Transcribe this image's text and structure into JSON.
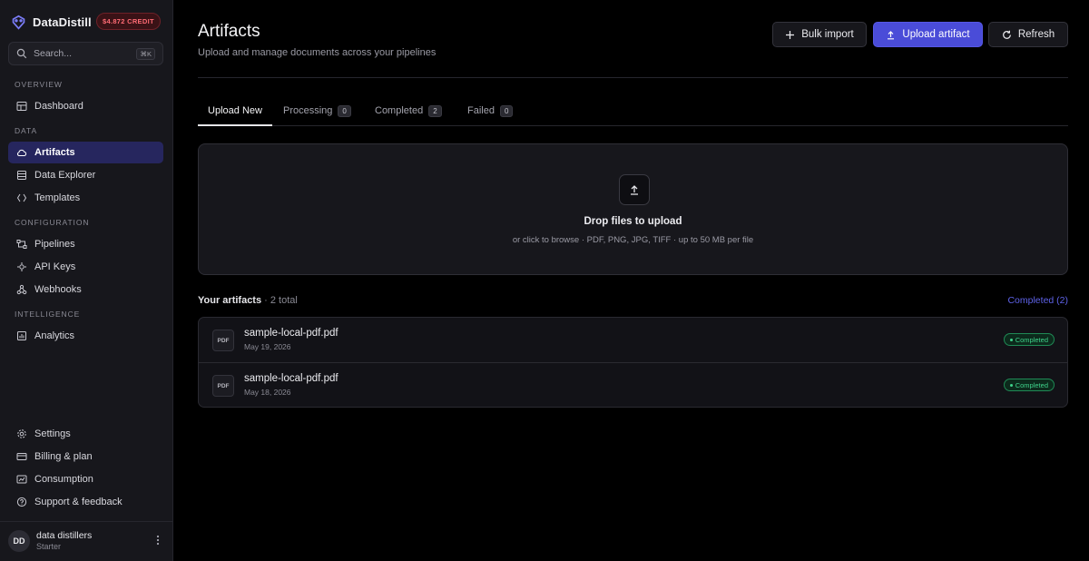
{
  "app": {
    "name": "DataDistill",
    "credit_badge": "$4.872 CREDIT",
    "brand_color": "#6e6ff0"
  },
  "search": {
    "placeholder": "Search...",
    "shortcut": "⌘K"
  },
  "sidebar": {
    "sections": [
      {
        "label": "OVERVIEW"
      },
      {
        "label": "DATA"
      },
      {
        "label": "CONFIGURATION"
      },
      {
        "label": "INTELLIGENCE"
      }
    ],
    "items": [
      {
        "label": "Dashboard",
        "icon": "dashboard-icon",
        "active": false
      },
      {
        "label": "Artifacts",
        "icon": "cloud-icon",
        "active": true
      },
      {
        "label": "Data Explorer",
        "icon": "table-icon",
        "active": false
      },
      {
        "label": "Templates",
        "icon": "code-braces-icon",
        "active": false
      },
      {
        "label": "Pipelines",
        "icon": "pipeline-icon",
        "active": false
      },
      {
        "label": "API Keys",
        "icon": "key-icon",
        "active": false
      },
      {
        "label": "Webhooks",
        "icon": "webhook-icon",
        "active": false
      },
      {
        "label": "Analytics",
        "icon": "chart-icon",
        "active": false
      }
    ],
    "bottom_items": [
      {
        "label": "Settings",
        "icon": "gear-icon"
      },
      {
        "label": "Billing & plan",
        "icon": "card-icon"
      },
      {
        "label": "Consumption",
        "icon": "gauge-icon"
      },
      {
        "label": "Support & feedback",
        "icon": "help-icon"
      }
    ]
  },
  "user": {
    "initials": "DD",
    "name": "data distillers",
    "plan": "Starter"
  },
  "header": {
    "title": "Artifacts",
    "subtitle": "Upload and manage documents across your pipelines",
    "bulk_import": "Bulk import",
    "upload": "Upload artifact",
    "refresh": "Refresh"
  },
  "tabs": [
    {
      "label": "Upload New",
      "active": true
    },
    {
      "label": "Processing",
      "count": "0"
    },
    {
      "label": "Completed",
      "count": "2"
    },
    {
      "label": "Failed",
      "count": "0"
    }
  ],
  "dropzone": {
    "title": "Drop files to upload",
    "subtitle": "or click to browse · PDF, PNG, JPG, TIFF · up to 50 MB per file"
  },
  "artifacts": {
    "heading": "Your artifacts",
    "total": "· 2 total",
    "filter": "Completed (2)",
    "items": [
      {
        "type": "PDF",
        "name": "sample-local-pdf.pdf",
        "date": "May 19, 2026",
        "status": "Completed"
      },
      {
        "type": "PDF",
        "name": "sample-local-pdf.pdf",
        "date": "May 18, 2026",
        "status": "Completed"
      }
    ]
  },
  "colors": {
    "accent": "#4a4cd8",
    "success": "#3fd38b",
    "danger": "#ff6b74",
    "background": "#000000",
    "sidebar": "#17171c"
  }
}
